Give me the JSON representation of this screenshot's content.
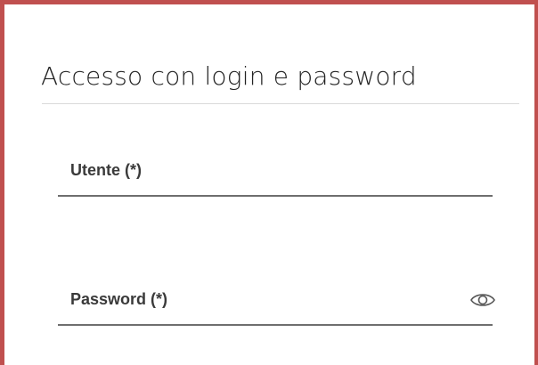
{
  "form": {
    "title": "Accesso con login e password",
    "username": {
      "label": "Utente (*)",
      "value": ""
    },
    "password": {
      "label": "Password (*)",
      "value": ""
    }
  },
  "icons": {
    "show_password": "eye-icon"
  },
  "colors": {
    "frame_border": "#c0504f",
    "title_text": "#222222",
    "field_label": "#3a3a3a",
    "field_underline": "#6e6e6e",
    "eye_icon": "#555555"
  }
}
